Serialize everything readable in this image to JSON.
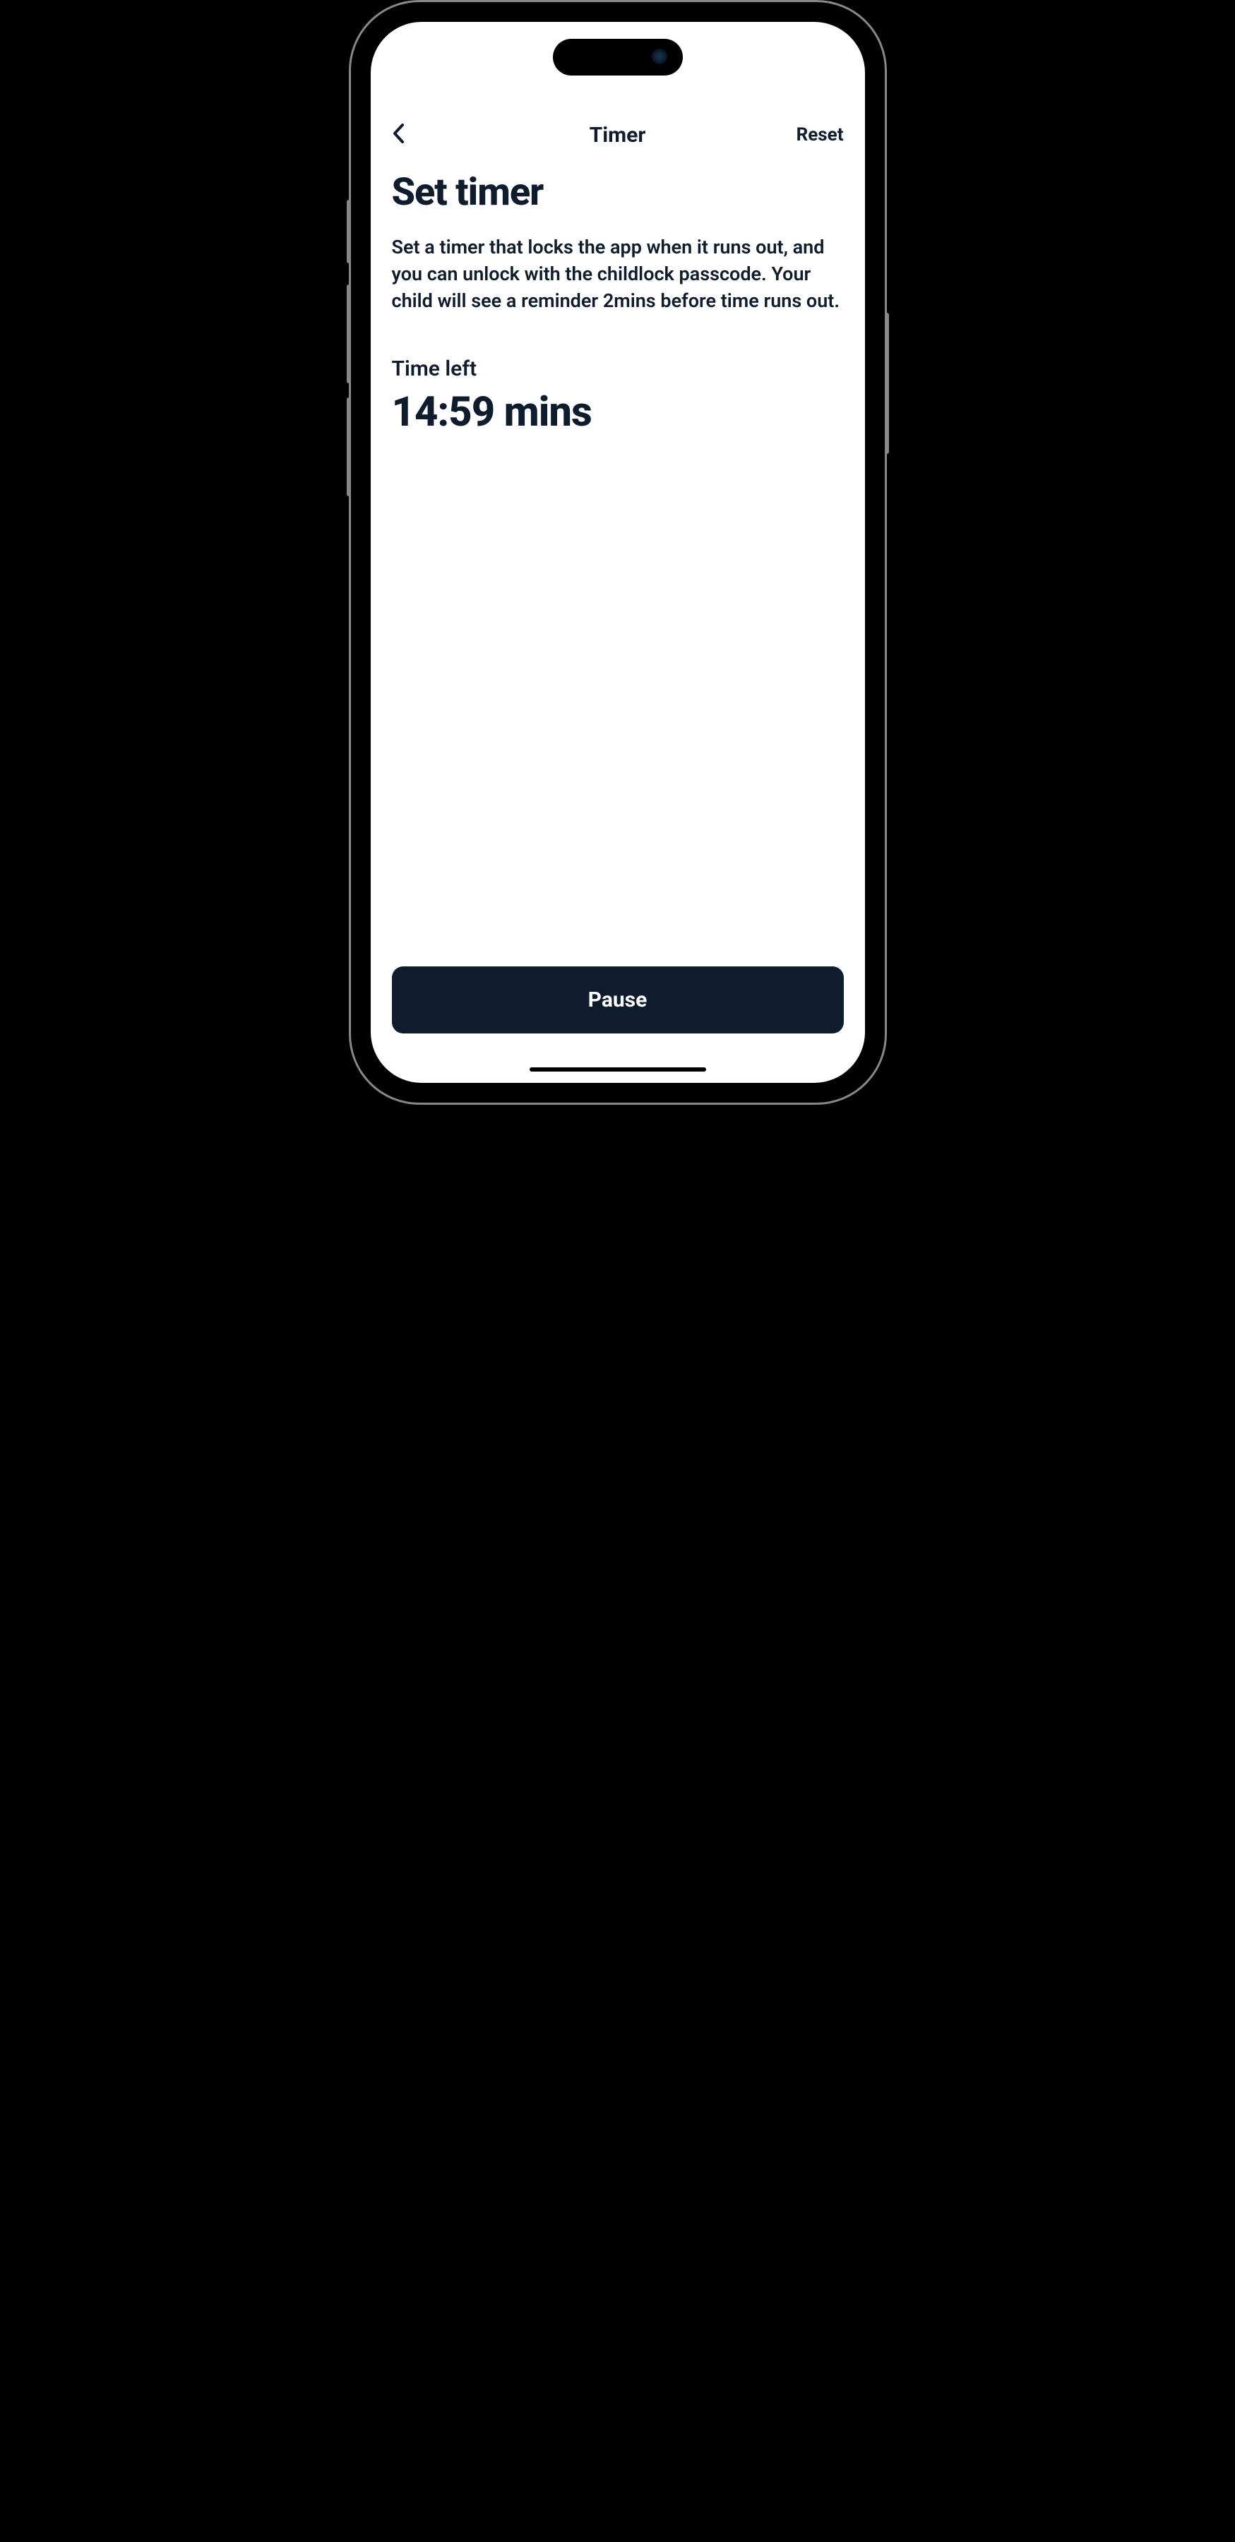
{
  "nav": {
    "title": "Timer",
    "reset_label": "Reset"
  },
  "page": {
    "title": "Set timer",
    "description": "Set a timer that locks the app when it runs out, and you can unlock with the childlock passcode. Your child will see a reminder 2mins before time runs out."
  },
  "timer": {
    "time_left_label": "Time left",
    "time_value": "14:59 mins"
  },
  "actions": {
    "pause_label": "Pause"
  }
}
